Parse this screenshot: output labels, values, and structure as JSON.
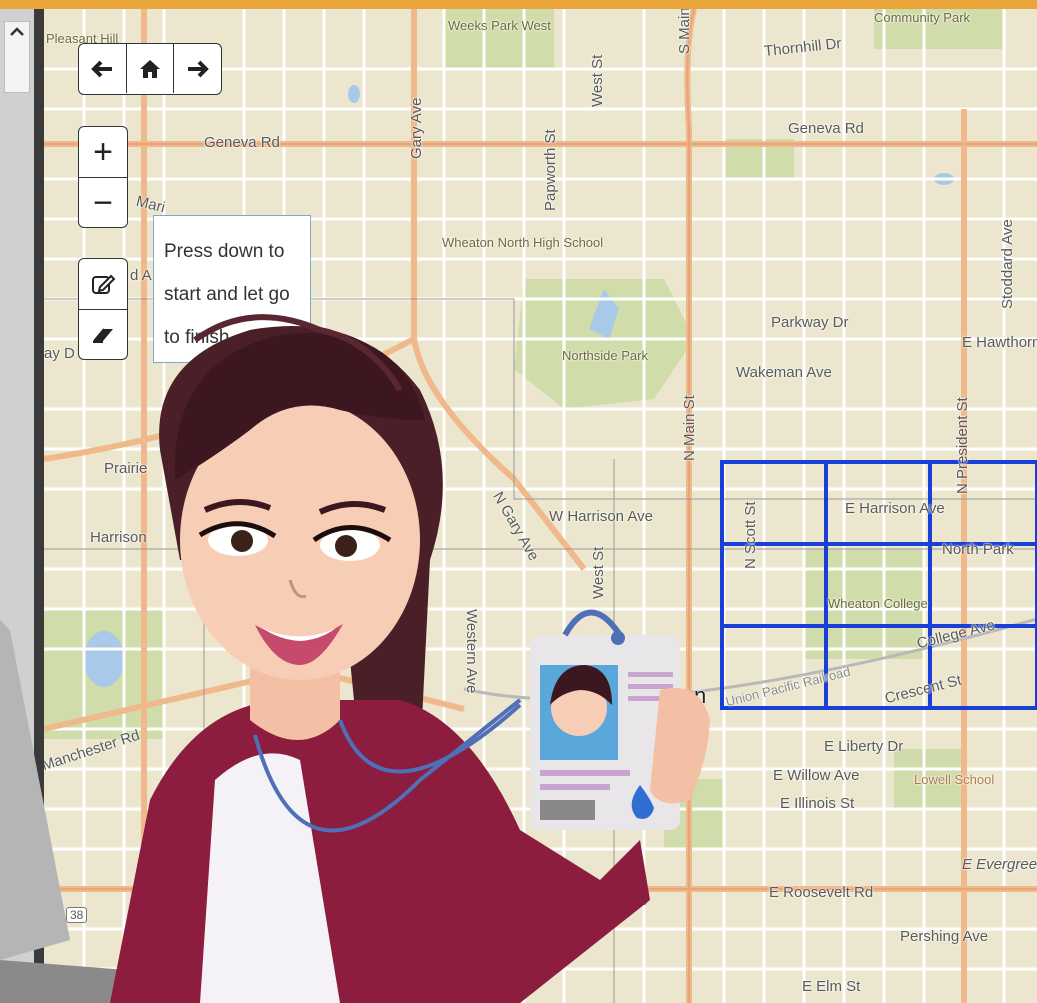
{
  "map": {
    "labels": {
      "weeks_park": "Weeks Park West",
      "pleasant_hill": "Pleasant Hill",
      "community_park": "Community Park",
      "thornhill": "Thornhill Dr",
      "geneva_rd_left": "Geneva Rd",
      "geneva_rd_right": "Geneva Rd",
      "gary_ave": "Gary Ave",
      "papworth": "Papworth St",
      "west_st": "West St",
      "s_main": "S Main",
      "stoddard": "Stoddard Ave",
      "wheaton_north": "Wheaton North High School",
      "parkway": "Parkway Dr",
      "e_hawthorne": "E Hawthorne",
      "northside_park": "Northside Park",
      "wakeman": "Wakeman Ave",
      "n_main": "N Main St",
      "n_president": "N President St",
      "prairie": "Prairie",
      "harrison_left": "Harrison",
      "n_gary": "N Gary Ave",
      "w_harrison": "W Harrison Ave",
      "west_st_2": "West St",
      "n_scott": "N Scott St",
      "e_harrison": "E Harrison Ave",
      "north_park": "North Park",
      "wheaton_college": "Wheaton College",
      "college_ave": "College Ave",
      "railroad": "Union Pacific Railroad",
      "crescent": "Crescent St",
      "western_ave": "Western Ave",
      "manchester": "Manchester Rd",
      "e_liberty": "E Liberty Dr",
      "e_willow": "E Willow Ave",
      "lowell_school": "Lowell School",
      "e_illinois": "E Illinois St",
      "e_evergreen": "E Evergreen",
      "e_roosevelt": "E Roosevelt Rd",
      "route_38_a": "38",
      "route_38_b": "38",
      "pershing": "Pershing Ave",
      "e_elm": "E Elm St",
      "partial_d": "d A",
      "partial_ay": "ay D",
      "marion": "Mari",
      "n_letter": "n"
    },
    "grid_color": "#1a3fd6"
  },
  "controls": {
    "back_icon": "arrow-left-icon",
    "home_icon": "home-icon",
    "forward_icon": "arrow-right-icon",
    "zoom_in": "+",
    "zoom_out": "−",
    "draw_icon": "pencil-square-icon",
    "erase_icon": "eraser-icon"
  },
  "tooltip": {
    "line1": "Press down to",
    "line2": "start and let go",
    "line3": "to finish"
  }
}
